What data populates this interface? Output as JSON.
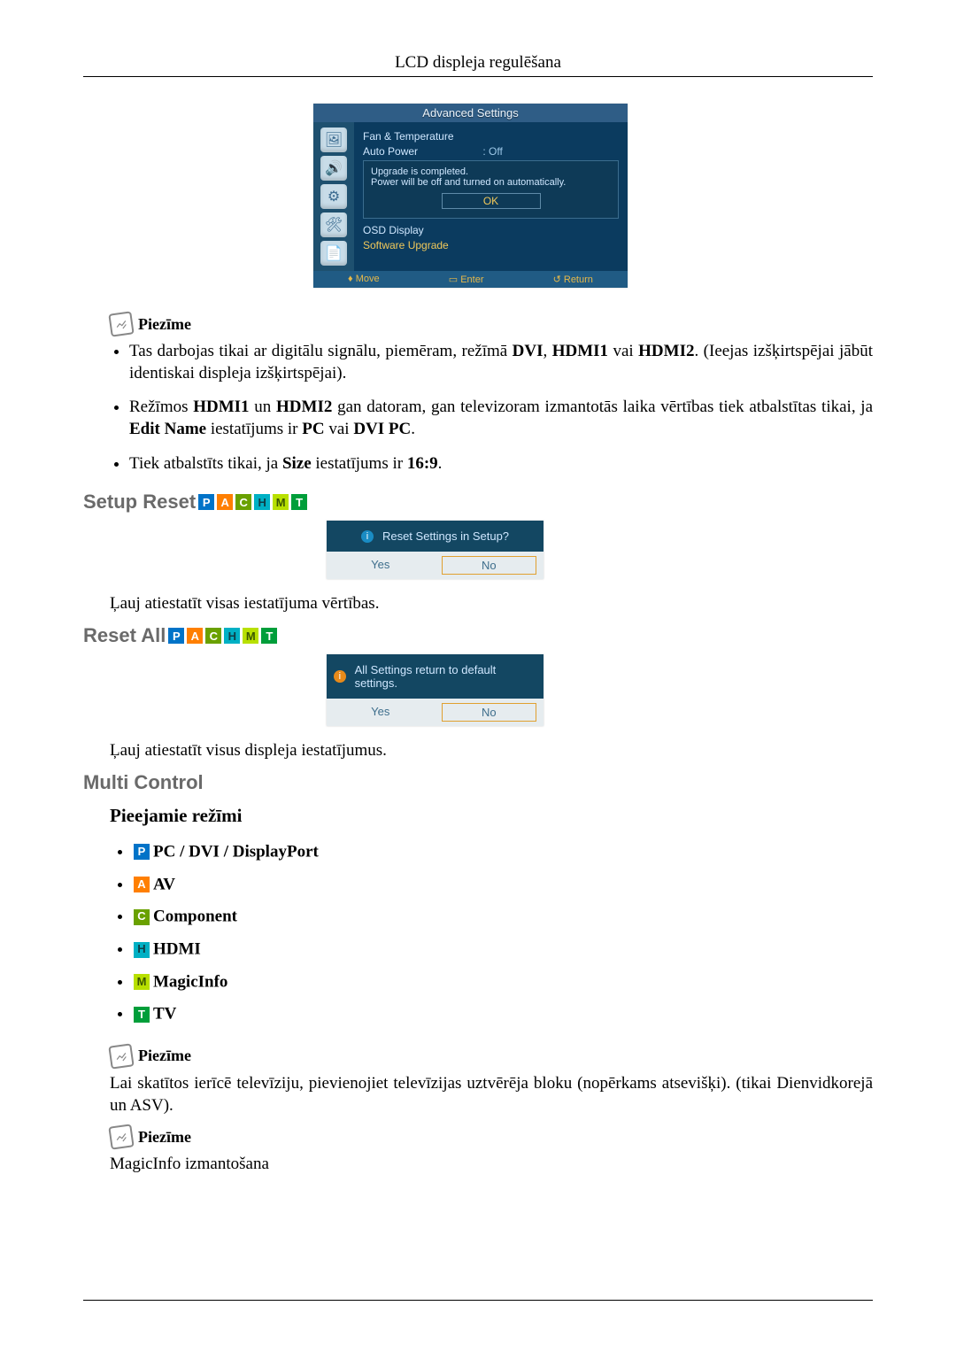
{
  "header": {
    "title": "LCD displeja regulēšana"
  },
  "osd": {
    "title": "Advanced Settings",
    "rows": {
      "fan": "Fan & Temperature",
      "autopower_label": "Auto Power",
      "autopower_value": ": Off",
      "upgrade_line1": "Upgrade is completed.",
      "upgrade_line2": "Power will be off and turned on automatically.",
      "ok": "OK",
      "osd_display": "OSD Display",
      "software_upgrade": "Software Upgrade"
    },
    "footer": {
      "move": "Move",
      "enter": "Enter",
      "return": "Return"
    }
  },
  "note_label": "Piezīme",
  "notes1": {
    "li1_a": "Tas darbojas tikai ar digitālu signālu, piemēram, režīmā ",
    "li1_b": ", ",
    "li1_c": " vai ",
    "li1_d": ". (Ieejas iz­šķirtspējai jābūt identiskai displeja izšķirtspējai).",
    "b_dvi": "DVI",
    "b_hdmi1": "HDMI1",
    "b_hdmi2": "HDMI2",
    "li2_a": "Režīmos ",
    "li2_b": " un ",
    "li2_c": " gan datoram, gan televizoram izmantotās laika vērtības tiek atbal­stītas tikai, ja ",
    "li2_d": " iestatījums ir ",
    "li2_e": " vai ",
    "li2_f": ".",
    "b_edit": "Edit Name",
    "b_pc": "PC",
    "b_dvipc": "DVI PC",
    "li3_a": "Tiek atbalstīts tikai, ja ",
    "li3_b": " iestatījums ir ",
    "li3_c": ".",
    "b_size": "Size",
    "b_169": "16:9"
  },
  "setup_reset": {
    "heading": "Setup Reset",
    "dialog_text": "Reset Settings in Setup?",
    "yes": "Yes",
    "no": "No",
    "desc": "Ļauj atiestatīt visas iestatījuma vērtības."
  },
  "reset_all": {
    "heading": "Reset All",
    "dialog_text": "All Settings return to default settings.",
    "yes": "Yes",
    "no": "No",
    "desc": "Ļauj atiestatīt visus displeja iestatījumus."
  },
  "multi": {
    "heading": "Multi Control",
    "sub": "Pieejamie režīmi",
    "modes": {
      "p": "PC / DVI / DisplayPort",
      "a": "AV",
      "c": "Component",
      "h": "HDMI",
      "m": "MagicInfo",
      "t": "TV"
    },
    "note2_text": "Lai skatītos ierīcē televīziju, pievienojiet televīzijas uztvērēja bloku (nopērkams atsevišķi). (tikai Di­envidkorejā un ASV).",
    "note3_text": "MagicInfo izmantošana"
  },
  "mode_letters": {
    "p": "P",
    "a": "A",
    "c": "C",
    "h": "H",
    "m": "M",
    "t": "T"
  }
}
